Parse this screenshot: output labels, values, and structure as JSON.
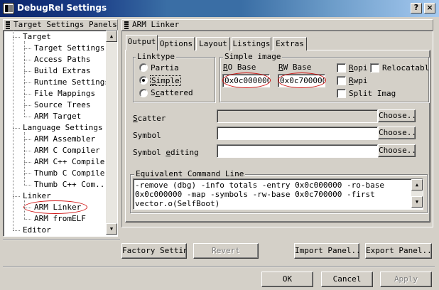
{
  "window": {
    "title": "DebugRel Settings",
    "help_glyph": "?",
    "close_glyph": "×"
  },
  "tree_panel": {
    "header": "Target Settings Panels",
    "items": [
      {
        "label": "Target",
        "level": 0
      },
      {
        "label": "Target Settings",
        "level": 1
      },
      {
        "label": "Access Paths",
        "level": 1
      },
      {
        "label": "Build Extras",
        "level": 1
      },
      {
        "label": "Runtime Settings",
        "level": 1
      },
      {
        "label": "File Mappings",
        "level": 1
      },
      {
        "label": "Source Trees",
        "level": 1
      },
      {
        "label": "ARM Target",
        "level": 1
      },
      {
        "label": "Language Settings",
        "level": 0
      },
      {
        "label": "ARM Assembler",
        "level": 1
      },
      {
        "label": "ARM C Compiler",
        "level": 1
      },
      {
        "label": "ARM C++ Compiler",
        "level": 1
      },
      {
        "label": "Thumb C Compiler",
        "level": 1
      },
      {
        "label": "Thumb C++ Com...",
        "level": 1
      },
      {
        "label": "Linker",
        "level": 0
      },
      {
        "label": "ARM Linker",
        "level": 1,
        "selected": true
      },
      {
        "label": "ARM fromELF",
        "level": 1
      },
      {
        "label": "Editor",
        "level": 0
      }
    ]
  },
  "right_panel": {
    "header": "ARM Linker",
    "tabs": [
      "Output",
      "Options",
      "Layout",
      "Listings",
      "Extras"
    ],
    "active_tab": "Output",
    "linktype": {
      "legend": "Linktype",
      "options": [
        {
          "pre": "",
          "key": "",
          "post": "Partia",
          "checked": false
        },
        {
          "pre": "",
          "key": "S",
          "post": "imple",
          "checked": true
        },
        {
          "pre": "S",
          "key": "c",
          "post": "attered",
          "checked": false
        }
      ]
    },
    "simple_image": {
      "legend": "Simple image",
      "ro_label_key": "R",
      "ro_label_rest": "O Base",
      "rw_label_key": "R",
      "rw_label_rest": "W Base",
      "ro_value": "0x0c000000",
      "rw_value": "0x0c700000",
      "checks": [
        {
          "key": "R",
          "rest": "opi",
          "checked": false
        },
        {
          "key": "",
          "rest": "Relocatabl",
          "checked": false
        },
        {
          "key": "R",
          "rest": "wpi",
          "checked": false
        },
        {
          "key": "",
          "rest": "Split Imag",
          "checked": false,
          "key_after": "I"
        }
      ]
    },
    "scatter": {
      "label_key": "S",
      "label_rest": "catter",
      "value": "",
      "button": "Choose..."
    },
    "symbol": {
      "label": "Symbol",
      "value": "",
      "button": "Choose..."
    },
    "symbol_editing": {
      "label_pre": "Symbol ",
      "label_key": "e",
      "label_rest": "diting",
      "value": "",
      "button": "Choose..."
    },
    "command_line": {
      "legend": "Equivalent Command Line",
      "lines": [
        "-remove (dbg) -info totals -entry 0x0c000000 -ro-base",
        "0x0c000000 -map -symbols -rw-base 0x0c700000 -first",
        "vector.o(SelfBoot)"
      ]
    }
  },
  "footer": {
    "factory": "Factory Settings",
    "revert": "Revert",
    "import": "Import Panel...",
    "export": "Export Panel...",
    "ok": "OK",
    "cancel": "Cancel",
    "apply": "Apply"
  },
  "colors": {
    "title_start": "#0a246a",
    "title_end": "#a6caf0",
    "face": "#d4d0c8",
    "annotation": "#d01010"
  }
}
